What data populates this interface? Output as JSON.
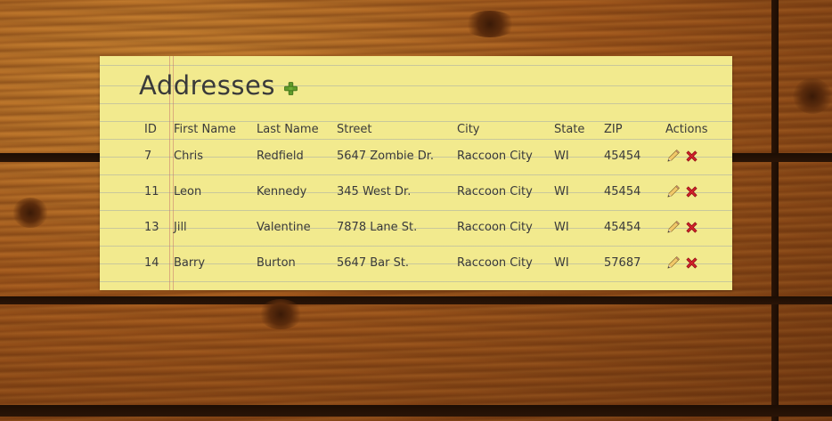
{
  "header": {
    "title": "Addresses",
    "add_icon": "plus-icon"
  },
  "table": {
    "columns": [
      "ID",
      "First Name",
      "Last Name",
      "Street",
      "City",
      "State",
      "ZIP",
      "Actions"
    ],
    "rows": [
      {
        "id": "7",
        "first": "Chris",
        "last": "Redfield",
        "street": "5647 Zombie Dr.",
        "city": "Raccoon City",
        "state": "WI",
        "zip": "45454"
      },
      {
        "id": "11",
        "first": "Leon",
        "last": "Kennedy",
        "street": "345 West Dr.",
        "city": "Raccoon City",
        "state": "WI",
        "zip": "45454"
      },
      {
        "id": "13",
        "first": "Jill",
        "last": "Valentine",
        "street": "7878 Lane St.",
        "city": "Raccoon City",
        "state": "WI",
        "zip": "45454"
      },
      {
        "id": "14",
        "first": "Barry",
        "last": "Burton",
        "street": "5647 Bar St.",
        "city": "Raccoon City",
        "state": "WI",
        "zip": "57687"
      }
    ],
    "row_icons": [
      "pencil-icon",
      "delete-x-icon"
    ]
  },
  "colors": {
    "paper": "#f2ea8e",
    "text": "#3a3a3a",
    "add_green": "#5f9a2a",
    "delete_red": "#d0202a"
  }
}
